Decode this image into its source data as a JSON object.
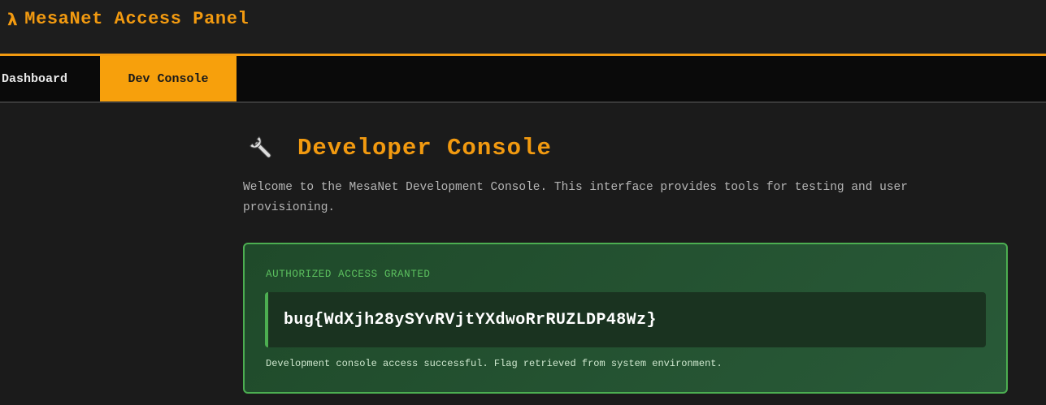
{
  "header": {
    "logo_glyph": "λ",
    "title": "MesaNet Access Panel"
  },
  "nav": {
    "tabs": [
      {
        "label": "Dashboard",
        "active": false
      },
      {
        "label": "Dev Console",
        "active": true
      }
    ]
  },
  "main": {
    "title": "Developer Console",
    "title_icon": "wrench-icon",
    "intro": "Welcome to the MesaNet Development Console. This interface provides tools for testing and user provisioning.",
    "panel": {
      "label": "AUTHORIZED ACCESS GRANTED",
      "flag": "bug{WdXjh28ySYvRVjtYXdwoRrRUZLDP48Wz}",
      "note": "Development console access successful. Flag retrieved from system environment."
    }
  },
  "colors": {
    "accent": "#f29a10",
    "success": "#4cae51",
    "background": "#1b1b1b"
  }
}
